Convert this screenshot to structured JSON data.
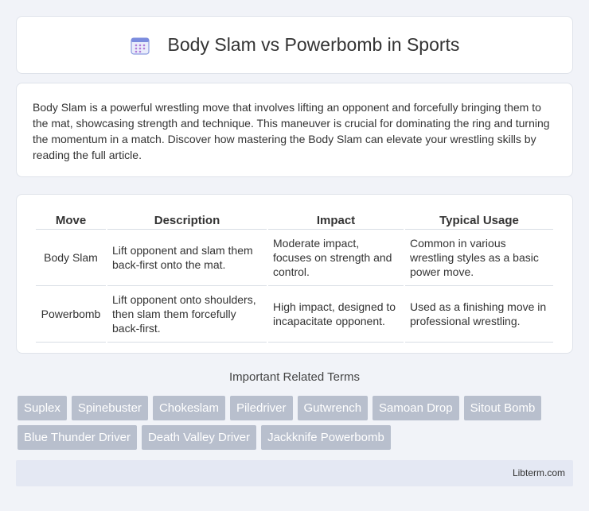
{
  "header": {
    "title": "Body Slam vs Powerbomb in Sports",
    "icon": "calendar-icon",
    "icon_color": "#7b8cde"
  },
  "intro": {
    "text": "Body Slam is a powerful wrestling move that involves lifting an opponent and forcefully bringing them to the mat, showcasing strength and technique. This maneuver is crucial for dominating the ring and turning the momentum in a match. Discover how mastering the Body Slam can elevate your wrestling skills by reading the full article."
  },
  "table": {
    "headers": [
      "Move",
      "Description",
      "Impact",
      "Typical Usage"
    ],
    "rows": [
      {
        "move": "Body Slam",
        "description": "Lift opponent and slam them back-first onto the mat.",
        "impact": "Moderate impact, focuses on strength and control.",
        "usage": "Common in various wrestling styles as a basic power move."
      },
      {
        "move": "Powerbomb",
        "description": "Lift opponent onto shoulders, then slam them forcefully back-first.",
        "impact": "High impact, designed to incapacitate opponent.",
        "usage": "Used as a finishing move in professional wrestling."
      }
    ]
  },
  "related": {
    "title": "Important Related Terms",
    "tags": [
      "Suplex",
      "Spinebuster",
      "Chokeslam",
      "Piledriver",
      "Gutwrench",
      "Samoan Drop",
      "Sitout Bomb",
      "Blue Thunder Driver",
      "Death Valley Driver",
      "Jackknife Powerbomb"
    ],
    "tag_color": "#b8bfcd"
  },
  "footer": {
    "text": "Libterm.com"
  }
}
